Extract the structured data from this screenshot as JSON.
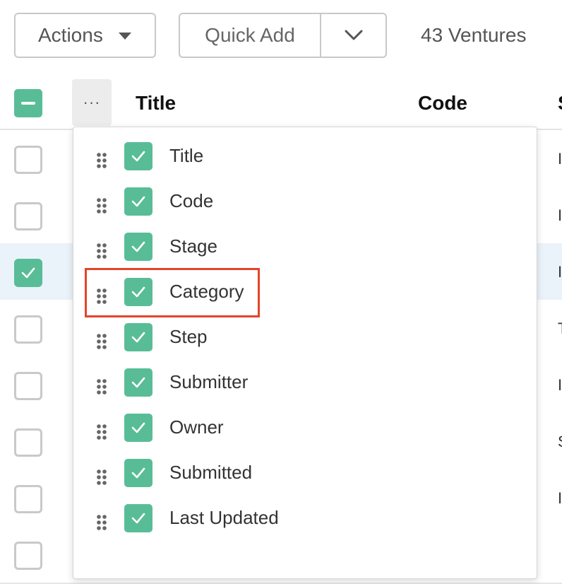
{
  "toolbar": {
    "actions_label": "Actions",
    "quick_add_label": "Quick Add",
    "count_text": "43 Ventures"
  },
  "table": {
    "headers": {
      "title": "Title",
      "code": "Code",
      "next": "S"
    },
    "rows": [
      {
        "edge": "I",
        "checked": false
      },
      {
        "edge": "I",
        "checked": false
      },
      {
        "edge": "I",
        "checked": true
      },
      {
        "edge": "T",
        "checked": false
      },
      {
        "edge": "I",
        "checked": false
      },
      {
        "edge": "S",
        "checked": false
      },
      {
        "edge": "I",
        "checked": false
      },
      {
        "edge": "",
        "checked": false
      }
    ]
  },
  "column_menu": {
    "button_glyph": "···",
    "items": [
      {
        "label": "Title",
        "checked": true
      },
      {
        "label": "Code",
        "checked": true
      },
      {
        "label": "Stage",
        "checked": true
      },
      {
        "label": "Category",
        "checked": true
      },
      {
        "label": "Step",
        "checked": true
      },
      {
        "label": "Submitter",
        "checked": true
      },
      {
        "label": "Owner",
        "checked": true
      },
      {
        "label": "Submitted",
        "checked": true
      },
      {
        "label": "Last Updated",
        "checked": true
      }
    ]
  },
  "colors": {
    "accent": "#58bd97",
    "highlight": "#e4442a",
    "selected_row": "#eaf2fa"
  }
}
